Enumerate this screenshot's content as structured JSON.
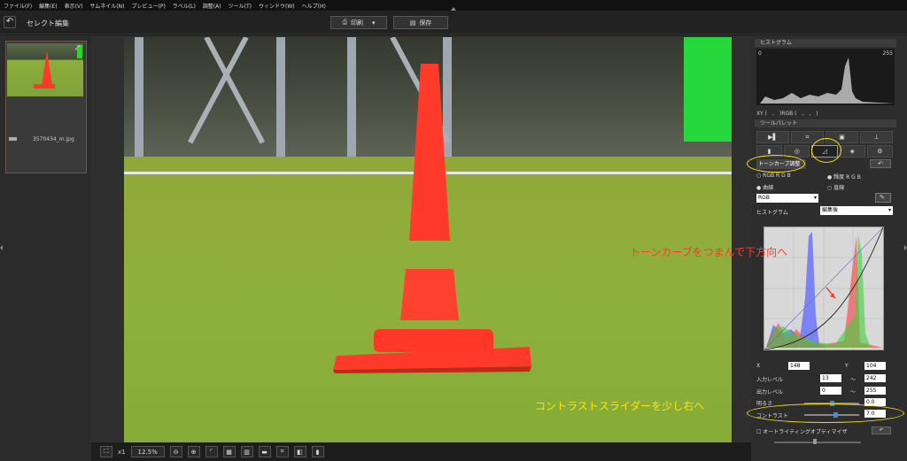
{
  "menu": {
    "items": [
      "ファイル(F)",
      "編集(E)",
      "表示(V)",
      "サムネイル(N)",
      "プレビュー(P)",
      "ラベル(L)",
      "調整(A)",
      "ツール(T)",
      "ウィンドウ(W)",
      "ヘルプ(H)"
    ]
  },
  "toolbar": {
    "title": "セレクト編集",
    "print_label": "印刷",
    "save_label": "保存"
  },
  "thumbnail": {
    "filename": "3570434_m.jpg"
  },
  "viewer": {
    "zoom_x": "x1",
    "zoom_percent": "12.5%"
  },
  "right_panel": {
    "histogram_header": "ヒストグラム",
    "hist_min": "0",
    "hist_max": "255",
    "xy_readout": "XY (　,　)RGB (　,　,　)",
    "tool_palette_header": "ツールパレット",
    "tone_curve_label": "トーンカーブ調整",
    "radio_rgb": "RGB R G B",
    "radio_luma": "輝度 R G B",
    "radio_curve": "曲線",
    "radio_line": "直線",
    "channel_select": "RGB",
    "histogram_label": "ヒストグラム",
    "histogram_select": "編集後",
    "x_label": "X",
    "x_value": "148",
    "y_label": "Y",
    "y_value": "104",
    "input_level_label": "入力レベル",
    "input_level_low": "13",
    "input_level_high": "242",
    "output_level_label": "出力レベル",
    "output_level_low": "0",
    "output_level_high": "255",
    "brightness_label": "明るさ",
    "brightness_value": "0.0",
    "contrast_label": "コントラスト",
    "contrast_value": "7.0",
    "auto_optimizer_label": "オートライティングオプティマイザ",
    "tilde": "〜"
  },
  "annotations": {
    "tone_curve_note": "トーンカーブをつまんで下方向へ",
    "contrast_note": "コントラストスライダーを少し右へ"
  },
  "colors": {
    "annotation_red": "#ff3b2a",
    "annotation_yellow": "#ffe400",
    "cone": "#ff3a2a"
  }
}
